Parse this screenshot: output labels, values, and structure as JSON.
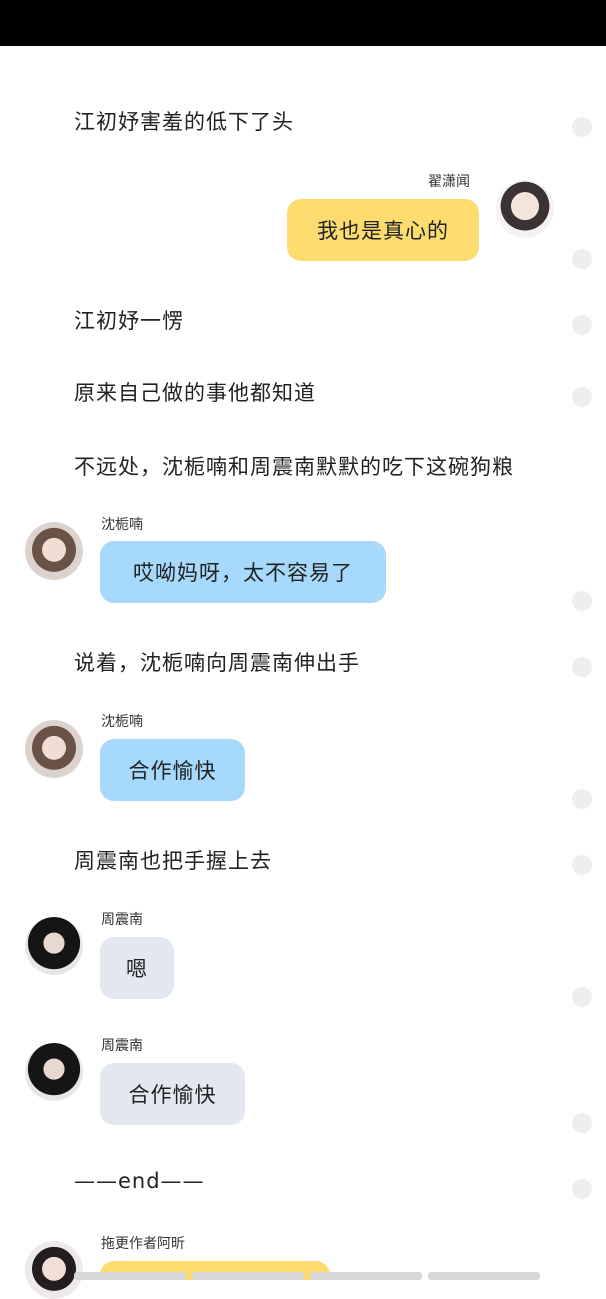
{
  "lines": {
    "l1": "江初妤害羞的低下了头",
    "l2": "江初妤一愣",
    "l3": "原来自己做的事他都知道",
    "l4": "不远处，沈栀喃和周震南默默的吃下这碗狗粮",
    "l5": "说着，沈栀喃向周震南伸出手",
    "l6": "周震南也把手握上去",
    "l7": "——end——"
  },
  "messages": [
    {
      "speaker": "翟潇闻",
      "text": "我也是真心的",
      "side": "right",
      "bubble_color": "#fcdc6f"
    },
    {
      "speaker": "沈栀喃",
      "text": "哎呦妈呀，太不容易了",
      "side": "left",
      "bubble_color": "#a6d9fb"
    },
    {
      "speaker": "沈栀喃",
      "text": "合作愉快",
      "side": "left",
      "bubble_color": "#a6d9fb"
    },
    {
      "speaker": "周震南",
      "text": "嗯",
      "side": "left",
      "bubble_color": "#e2e7f0"
    },
    {
      "speaker": "周震南",
      "text": "合作愉快",
      "side": "left",
      "bubble_color": "#e2e7f0"
    },
    {
      "speaker": "拖更作者阿昕",
      "text": "",
      "side": "left",
      "bubble_color": "#fcdc6f"
    }
  ],
  "icons": {
    "avatar_zhai": "avatar-boy-icon",
    "avatar_shen": "avatar-girl-icon",
    "avatar_zhou": "avatar-dark-hair-icon",
    "avatar_author": "avatar-author-icon",
    "side_dot": "comment-dot-icon"
  }
}
